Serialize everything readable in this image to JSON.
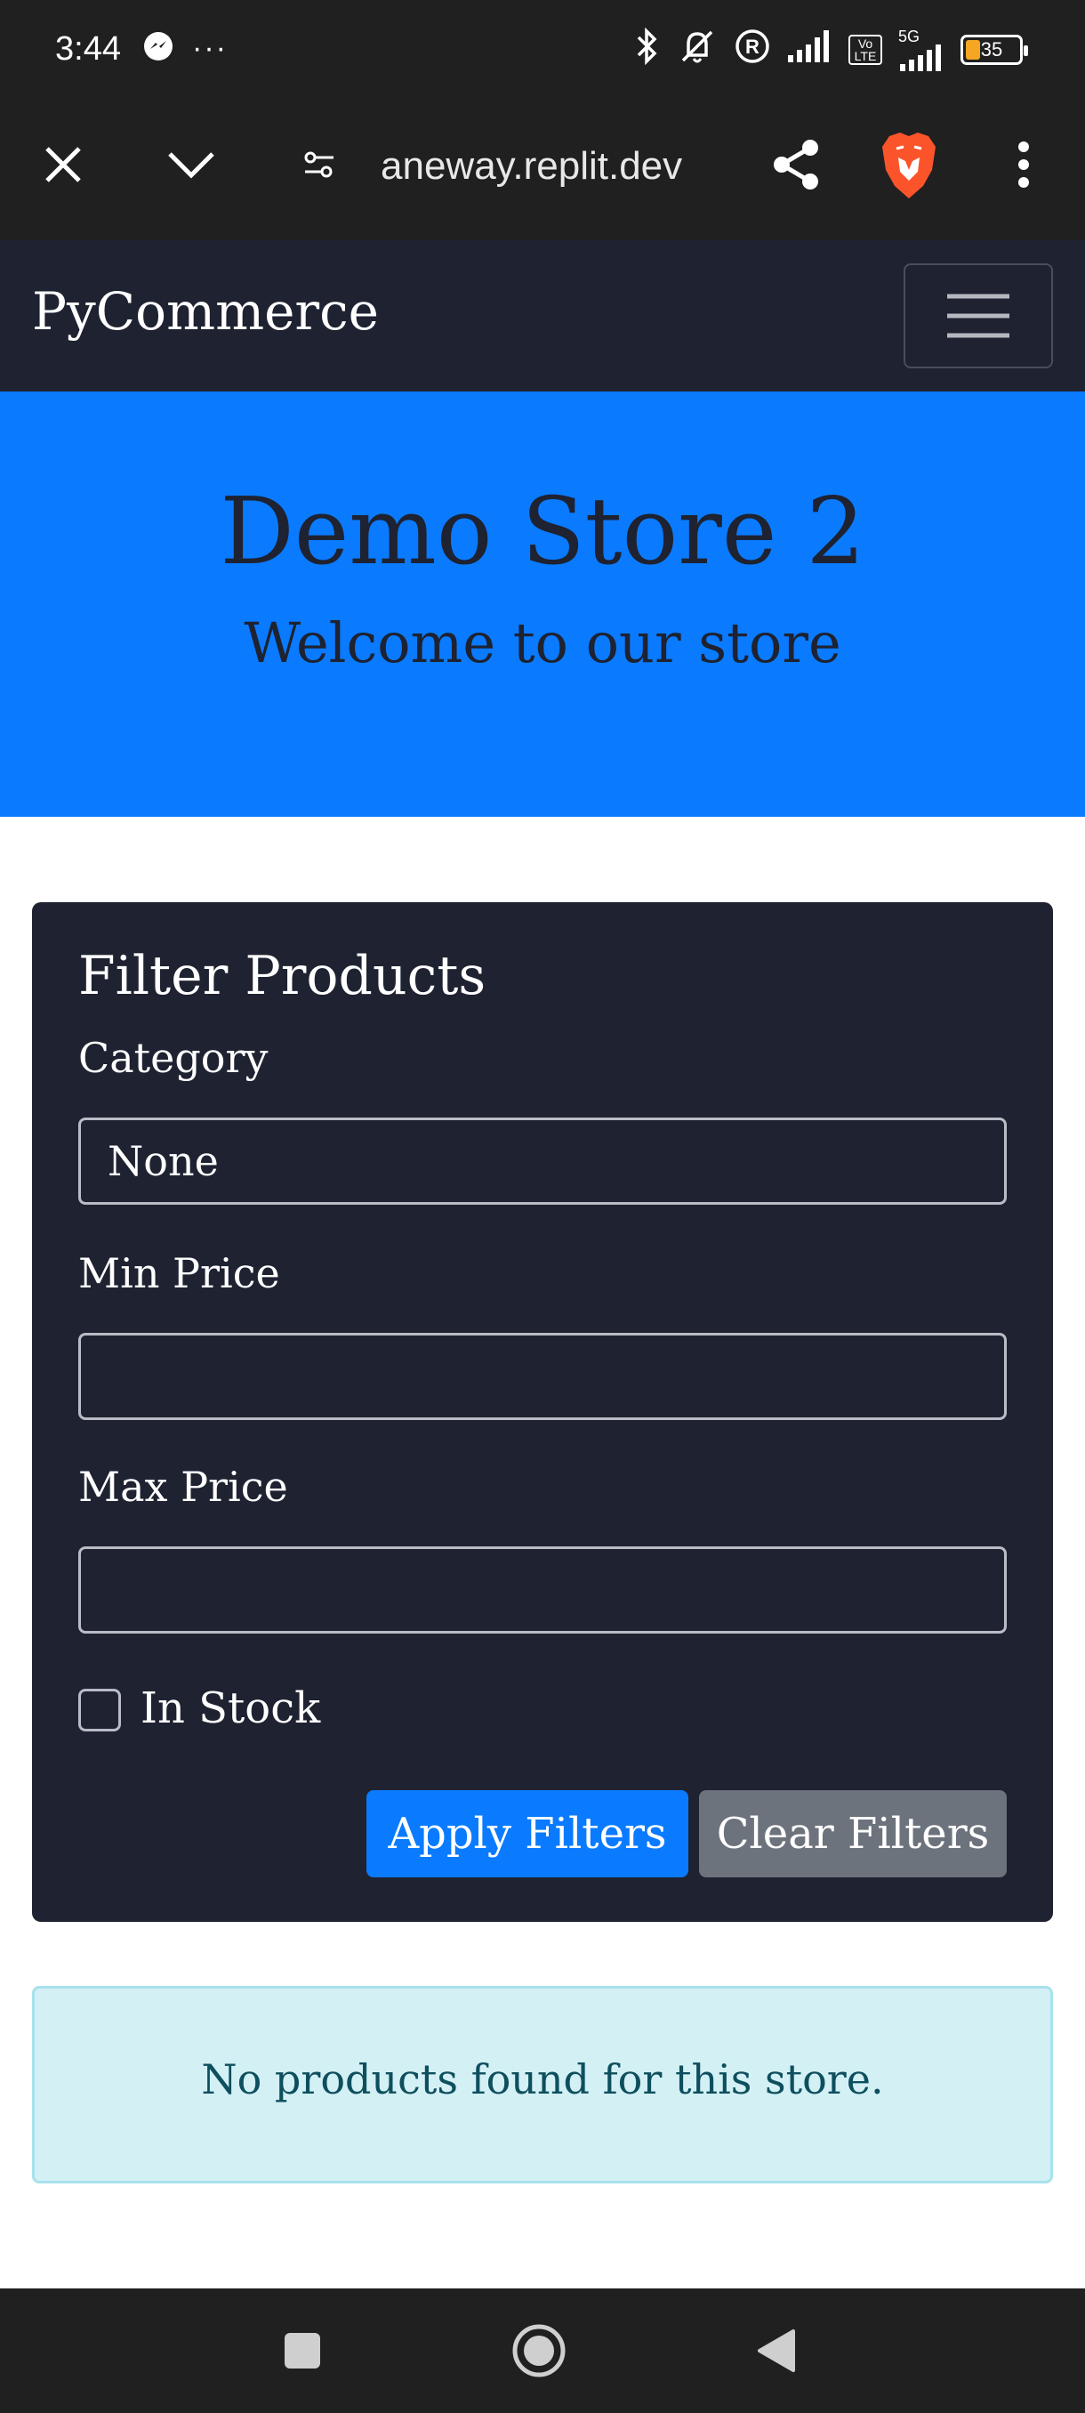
{
  "status_bar": {
    "time": "3:44",
    "more": "···",
    "battery": "35",
    "network": "5G",
    "volte": "Vo LTE"
  },
  "browser": {
    "url": "aneway.replit.dev"
  },
  "navbar": {
    "brand": "PyCommerce"
  },
  "hero": {
    "title": "Demo Store 2",
    "subtitle": "Welcome to our store"
  },
  "filter": {
    "title": "Filter Products",
    "category_label": "Category",
    "category_value": "None",
    "min_price_label": "Min Price",
    "min_price_value": "",
    "max_price_label": "Max Price",
    "max_price_value": "",
    "in_stock_label": "In Stock",
    "apply_label": "Apply Filters",
    "clear_label": "Clear Filters"
  },
  "alert": {
    "message": "No products found for this store."
  },
  "colors": {
    "navbar_bg": "#1e2231",
    "hero_bg": "#0a7bff",
    "primary": "#0a7bff",
    "secondary": "#6c737d",
    "alert_bg": "#d3f0f5"
  }
}
